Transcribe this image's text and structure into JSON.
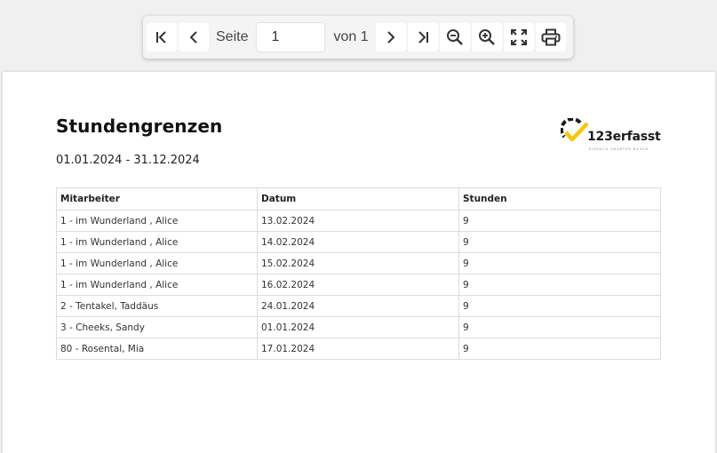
{
  "toolbar": {
    "page_label": "Seite",
    "page_value": "1",
    "of_label": "von 1",
    "buttons": [
      {
        "icon": "first-page-icon"
      },
      {
        "icon": "previous-page-icon"
      },
      {
        "icon": "next-page-icon"
      },
      {
        "icon": "last-page-icon"
      },
      {
        "icon": "zoom-out-icon"
      },
      {
        "icon": "zoom-in-icon"
      },
      {
        "icon": "fullscreen-icon"
      },
      {
        "icon": "print-icon"
      }
    ]
  },
  "document": {
    "title": "Stundengrenzen",
    "date_range": "01.01.2024 - 31.12.2024",
    "logo": {
      "text": "123erfasst",
      "tagline": "EINFACH SMARTER BAUEN",
      "accent_color": "#f5c800",
      "dark_color": "#1a1a1a"
    },
    "table": {
      "headers": [
        "Mitarbeiter",
        "Datum",
        "Stunden"
      ],
      "rows": [
        [
          "1 - im Wunderland , Alice",
          "13.02.2024",
          "9"
        ],
        [
          "1 - im Wunderland , Alice",
          "14.02.2024",
          "9"
        ],
        [
          "1 - im Wunderland , Alice",
          "15.02.2024",
          "9"
        ],
        [
          "1 - im Wunderland , Alice",
          "16.02.2024",
          "9"
        ],
        [
          "2 - Tentakel, Taddäus",
          "24.01.2024",
          "9"
        ],
        [
          "3 - Cheeks, Sandy",
          "01.01.2024",
          "9"
        ],
        [
          "80 - Rosental, Mia",
          "17.01.2024",
          "9"
        ]
      ]
    }
  }
}
